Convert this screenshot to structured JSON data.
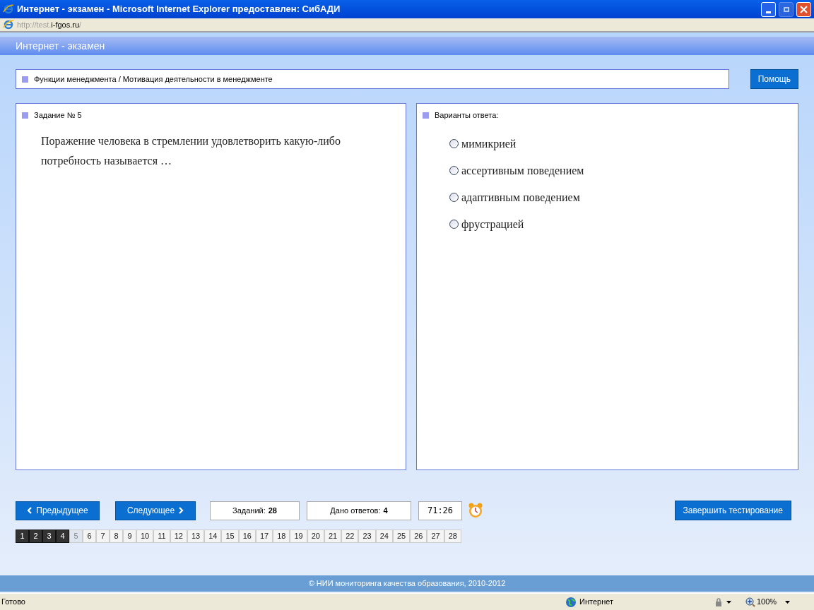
{
  "window": {
    "title": "Интернет - экзамен - Microsoft Internet Explorer предоставлен: СибАДИ"
  },
  "address": {
    "prefix": "http://test.",
    "host": "i-fgos.ru",
    "suffix": "/"
  },
  "app_title": "Интернет - экзамен",
  "breadcrumb": "Функции менеджмента / Мотивация деятельности в менеджменте",
  "help_button": "Помощь",
  "task": {
    "heading": "Задание № 5",
    "question": "Поражение человека в стремлении удовлетворить какую-либо потребность называется …"
  },
  "answers": {
    "heading": "Варианты ответа:",
    "options": [
      {
        "label": "мимикрией",
        "selected": false
      },
      {
        "label": "ассертивным поведением",
        "selected": false
      },
      {
        "label": "адаптивным поведением",
        "selected": false
      },
      {
        "label": "фрустрацией",
        "selected": false
      }
    ]
  },
  "nav": {
    "prev": "Предыдущее",
    "next": "Следующее",
    "tasks_label": "Заданий:",
    "tasks_count": "28",
    "answered_label": "Дано ответов:",
    "answered_count": "4",
    "timer": "71:26",
    "finish": "Завершить тестирование"
  },
  "pages": [
    {
      "label": "1",
      "answered": true,
      "selected": false
    },
    {
      "label": "2",
      "answered": true,
      "selected": false
    },
    {
      "label": "3",
      "answered": true,
      "selected": false
    },
    {
      "label": "4",
      "answered": true,
      "selected": false
    },
    {
      "label": "5",
      "answered": false,
      "selected": true
    },
    {
      "label": "6",
      "answered": false,
      "selected": false
    },
    {
      "label": "7",
      "answered": false,
      "selected": false
    },
    {
      "label": "8",
      "answered": false,
      "selected": false
    },
    {
      "label": "9",
      "answered": false,
      "selected": false
    },
    {
      "label": "10",
      "answered": false,
      "selected": false
    },
    {
      "label": "11",
      "answered": false,
      "selected": false
    },
    {
      "label": "12",
      "answered": false,
      "selected": false
    },
    {
      "label": "13",
      "answered": false,
      "selected": false
    },
    {
      "label": "14",
      "answered": false,
      "selected": false
    },
    {
      "label": "15",
      "answered": false,
      "selected": false
    },
    {
      "label": "16",
      "answered": false,
      "selected": false
    },
    {
      "label": "17",
      "answered": false,
      "selected": false
    },
    {
      "label": "18",
      "answered": false,
      "selected": false
    },
    {
      "label": "19",
      "answered": false,
      "selected": false
    },
    {
      "label": "20",
      "answered": false,
      "selected": false
    },
    {
      "label": "21",
      "answered": false,
      "selected": false
    },
    {
      "label": "22",
      "answered": false,
      "selected": false
    },
    {
      "label": "23",
      "answered": false,
      "selected": false
    },
    {
      "label": "24",
      "answered": false,
      "selected": false
    },
    {
      "label": "25",
      "answered": false,
      "selected": false
    },
    {
      "label": "26",
      "answered": false,
      "selected": false
    },
    {
      "label": "27",
      "answered": false,
      "selected": false
    },
    {
      "label": "28",
      "answered": false,
      "selected": false
    }
  ],
  "footer": "© НИИ мониторинга качества образования, 2010-2012",
  "status_bar": {
    "text": "Готово",
    "zone": "Интернет",
    "zoom": "100%"
  }
}
